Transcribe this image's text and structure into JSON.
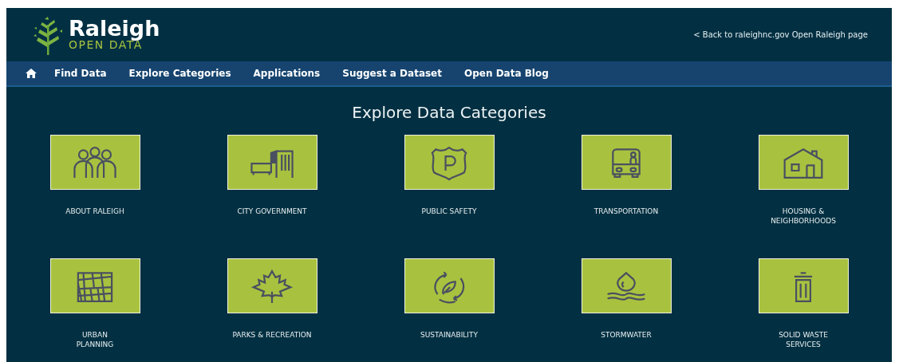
{
  "header": {
    "logo_title": "Raleigh",
    "logo_subtitle": "OPEN DATA",
    "back_link": "< Back to raleighnc.gov Open Raleigh page"
  },
  "nav": {
    "items": [
      {
        "label": "Find Data"
      },
      {
        "label": "Explore Categories"
      },
      {
        "label": "Applications"
      },
      {
        "label": "Suggest a Dataset"
      },
      {
        "label": "Open Data Blog"
      }
    ]
  },
  "heading": "Explore Data Categories",
  "categories": [
    {
      "lines": [
        "ABOUT RALEIGH"
      ]
    },
    {
      "lines": [
        "CITY GOVERNMENT"
      ]
    },
    {
      "lines": [
        "PUBLIC SAFETY"
      ]
    },
    {
      "lines": [
        "TRANSPORTATION"
      ]
    },
    {
      "lines": [
        "HOUSING &",
        "NEIGHBORHOODS"
      ]
    },
    {
      "lines": [
        "URBAN",
        "PLANNING"
      ]
    },
    {
      "lines": [
        "PARKS & RECREATION"
      ]
    },
    {
      "lines": [
        "SUSTAINABILITY"
      ]
    },
    {
      "lines": [
        "STORMWATER"
      ]
    },
    {
      "lines": [
        "SOLID WASTE",
        "SERVICES"
      ]
    }
  ]
}
